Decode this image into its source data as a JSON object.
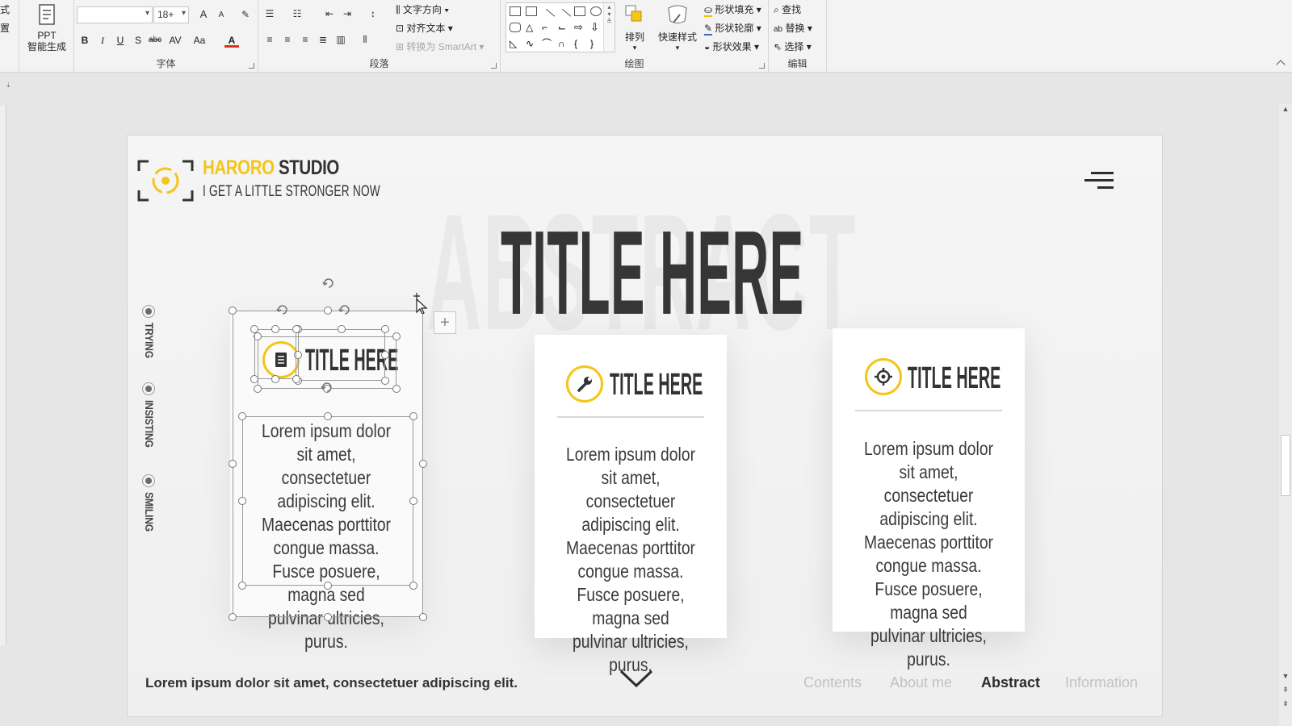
{
  "ribbon": {
    "left_stub": {
      "a": "式",
      "b": "置"
    },
    "ppt_ai": {
      "line1": "PPT",
      "line2": "智能生成"
    },
    "font": {
      "label": "字体",
      "font_name": "",
      "font_size": "18+",
      "grow": "A",
      "shrink": "A",
      "bold": "B",
      "italic": "I",
      "underline": "U",
      "shadow": "S",
      "strike": "abc",
      "spacing": "AV",
      "case": "Aa",
      "color": "A"
    },
    "paragraph": {
      "label": "段落",
      "text_direction": "文字方向",
      "align_text": "对齐文本",
      "smartart": "转换为 SmartArt"
    },
    "drawing": {
      "label": "绘图",
      "arrange": "排列",
      "quick_styles": "快速样式",
      "shape_fill": "形状填充",
      "shape_outline": "形状轮廓",
      "shape_effects": "形状效果"
    },
    "editing": {
      "label": "编辑",
      "find": "查找",
      "replace": "替换",
      "select": "选择"
    }
  },
  "slide": {
    "brand_accent": "HARORO",
    "brand_main": "STUDIO",
    "tagline": "I GET A LITTLE STRONGER NOW",
    "background_word": "ABSTRACT",
    "main_title": "TITLE HERE",
    "side_nav": [
      "TRYING",
      "INSISTING",
      "SMILING"
    ],
    "cards": [
      {
        "title": "TITLE HERE",
        "icon": "document-icon",
        "body": "Lorem ipsum dolor sit amet, consectetuer adipiscing elit. Maecenas porttitor congue massa. Fusce posuere, magna sed pulvinar ultricies, purus."
      },
      {
        "title": "TITLE HERE",
        "icon": "wrench-icon",
        "body": "Lorem ipsum dolor sit amet, consectetuer adipiscing elit. Maecenas porttitor congue massa. Fusce posuere, magna sed pulvinar ultricies, purus."
      },
      {
        "title": "TITLE HERE",
        "icon": "crosshair-icon",
        "body": "Lorem ipsum dolor sit amet, consectetuer adipiscing elit. Maecenas porttitor congue massa. Fusce posuere, magna sed pulvinar ultricies, purus."
      }
    ],
    "footer_text": "Lorem ipsum dolor sit amet, consectetuer adipiscing elit.",
    "footer_nav": [
      {
        "label": "Contents",
        "active": false
      },
      {
        "label": "About me",
        "active": false
      },
      {
        "label": "Abstract",
        "active": true
      },
      {
        "label": "Information",
        "active": false
      }
    ]
  },
  "colors": {
    "accent": "#f5c518",
    "dark": "#333333",
    "muted": "#c2c2c2"
  }
}
